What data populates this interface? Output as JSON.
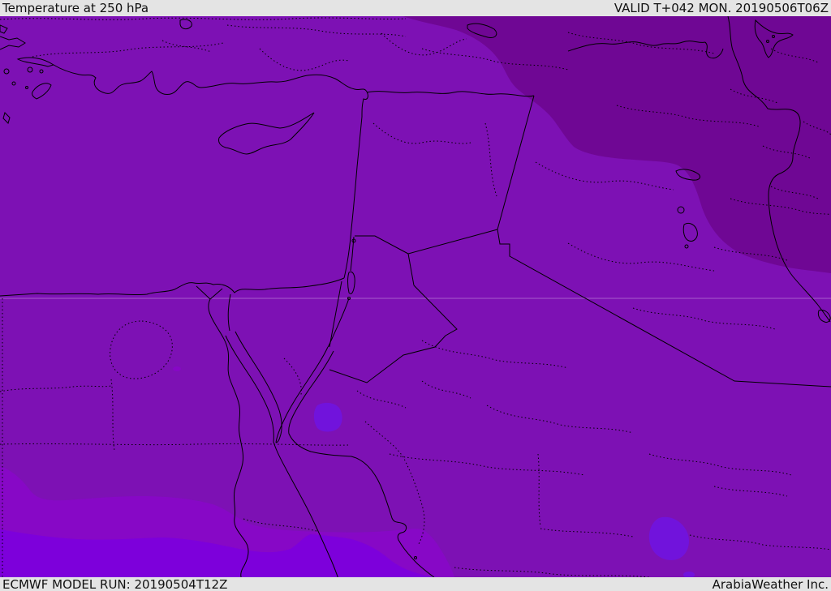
{
  "header": {
    "title": "Temperature at 250 hPa",
    "valid": "VALID T+042 MON. 20190506T06Z"
  },
  "footer": {
    "model_run": "ECMWF MODEL RUN: 20190504T12Z",
    "brand": "ArabiaWeather Inc."
  },
  "colors": {
    "bar_bg": "#e4e4e4",
    "bar_text": "#111111",
    "base": "#7D11B4",
    "dark_region": "#6F0794",
    "medium_band": "#8708C6",
    "bright_band": "#7D00DB",
    "hot_spot": "#7113DC",
    "border_line": "#000000",
    "graticule": "#ffffff"
  },
  "map": {
    "description": "ECMWF 250 hPa temperature shading over the Middle East",
    "temperature_shading": [
      {
        "region": "northeast corner (Iran / Caspian)",
        "tone": "darkest purple"
      },
      {
        "region": "central Middle East (Turkey, Levant, Egypt, Iraq, Arabia)",
        "tone": "purple"
      },
      {
        "region": "southwest band (southern Egypt / Libya)",
        "tone": "lighter violet"
      },
      {
        "region": "bottom-left corner band",
        "tone": "bright violet"
      },
      {
        "region": "spot near Gulf of Aqaba",
        "tone": "bright violet spot"
      },
      {
        "region": "spot in central Saudi Arabia (bottom)",
        "tone": "bright violet spot"
      }
    ]
  }
}
